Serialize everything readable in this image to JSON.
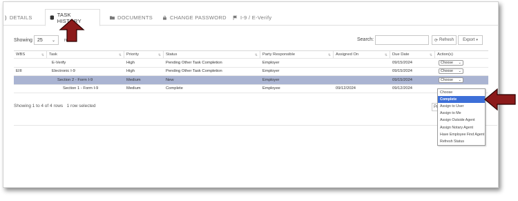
{
  "tabs": [
    {
      "label": "DETAILS",
      "icon": "partial-icon"
    },
    {
      "label": "TASK HISTORY",
      "icon": "database-icon",
      "active": true
    },
    {
      "label": "DOCUMENTS",
      "icon": "folder-icon"
    },
    {
      "label": "CHANGE PASSWORD",
      "icon": "lock-icon"
    },
    {
      "label": "I-9 / E-Verify",
      "icon": "flag-icon"
    }
  ],
  "toolbar": {
    "showing_label": "Showing",
    "page_size": "25",
    "rows_suffix": "ro",
    "search_label": "Search:",
    "search_value": "",
    "refresh_label": "Refresh",
    "export_label": "Export"
  },
  "table": {
    "columns": [
      "WBS",
      "Task",
      "Priority",
      "Status",
      "Party Responsible",
      "Assigned On",
      "Due Date",
      "Action(s)"
    ],
    "rows": [
      {
        "wbs": "",
        "task": "E-Verify",
        "priority": "High",
        "status": "Pending Other Task Completion",
        "party": "Employer",
        "assigned": "",
        "due": "09/15/2024",
        "action": "Choose"
      },
      {
        "wbs": "EIII",
        "task": "Electronic I-9",
        "priority": "High",
        "status": "Pending Other Task Completion",
        "party": "Employer",
        "assigned": "",
        "due": "09/15/2024",
        "action": "Choose"
      },
      {
        "wbs": "",
        "task": "Section 2 - Form I-9",
        "priority": "Medium",
        "status": "New",
        "party": "Employer",
        "assigned": "",
        "due": "09/15/2024",
        "action": "Choose",
        "selected": true
      },
      {
        "wbs": "",
        "task": "Section 1 - Form I-9",
        "priority": "Medium",
        "status": "Complete",
        "party": "Employee",
        "assigned": "09/12/2024",
        "due": "09/12/2024",
        "action": ""
      }
    ]
  },
  "footer": {
    "summary": "Showing 1 to 4 of 4 rows",
    "selection": "1 row selected",
    "pager_partial": "Pr"
  },
  "action_menu": {
    "options": [
      "Choose",
      "Complete",
      "Assign to User",
      "Assign to Me",
      "Assign Outside Agent",
      "Assign Notary Agent",
      "Have Employee Find Agent",
      "Refresh Status"
    ],
    "highlighted": "Complete"
  },
  "colors": {
    "selected_row": "#aab4d2",
    "menu_highlight": "#3d6fd8",
    "annotation_arrow": "#8b1a1a"
  }
}
